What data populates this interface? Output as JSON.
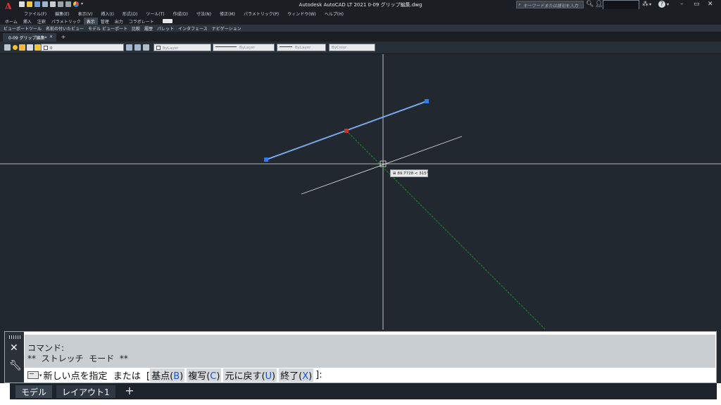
{
  "titlebar": {
    "app_logo": "A",
    "title": "Autodesk AutoCAD LT 2021    0-09 グリップ編集.dwg",
    "search_placeholder": "キーワードまたは語句を入力",
    "help_icon": "?",
    "minimize": "–",
    "restore": "▭",
    "close": "✕"
  },
  "menubar": {
    "items": [
      "ファイル(F)",
      "編集(E)",
      "表示(V)",
      "挿入(I)",
      "形式(O)",
      "ツール(T)",
      "作成(D)",
      "寸法(N)",
      "修正(M)",
      "パラメトリック(P)",
      "ウィンドウ(W)",
      "ヘルプ(H)"
    ]
  },
  "ribbon": {
    "tabs": [
      "ホーム",
      "挿入",
      "注釈",
      "パラメトリック",
      "表示",
      "管理",
      "出力",
      "コラボレート"
    ],
    "active_tab": "表示",
    "panels": [
      "ビューポートツール",
      "名前の付いたビュー",
      "モデル ビューポート",
      "比較",
      "履歴",
      "パレット",
      "インタフェース",
      "ナビゲーション"
    ]
  },
  "filetabs": {
    "active_file": "0-09 グリップ編集*",
    "close_icon": "✕",
    "new_tab": "+"
  },
  "properties": {
    "layer_value": "0",
    "color": "ByLayer",
    "linetype": "ByLayer",
    "lineweight": "ByLayer",
    "plotstyle": "ByColor"
  },
  "drawing": {
    "tooltip": "89.7728 < 315°",
    "colors": {
      "background": "#212830",
      "selected_line": "#7aa6e8",
      "grip": "#2f7cf0",
      "hot_grip": "#c0392b",
      "rubberband": "#2e8b3a",
      "crosshair": "#e6e6e6"
    }
  },
  "commandline": {
    "history": [
      "コマンド:",
      "**  ストレッチ  モード  **"
    ],
    "prompt": "新しい点を指定  または  [",
    "options": [
      {
        "label": "基点(",
        "key": "B",
        "close": ")"
      },
      {
        "label": "複写(",
        "key": "C",
        "close": ")"
      },
      {
        "label": "元に戻す(",
        "key": "U",
        "close": ")"
      },
      {
        "label": "終了(",
        "key": "X",
        "close": ")"
      }
    ],
    "prompt_end": "]:"
  },
  "layout_tabs": {
    "model": "モデル",
    "layout1": "レイアウト1",
    "add": "+"
  }
}
